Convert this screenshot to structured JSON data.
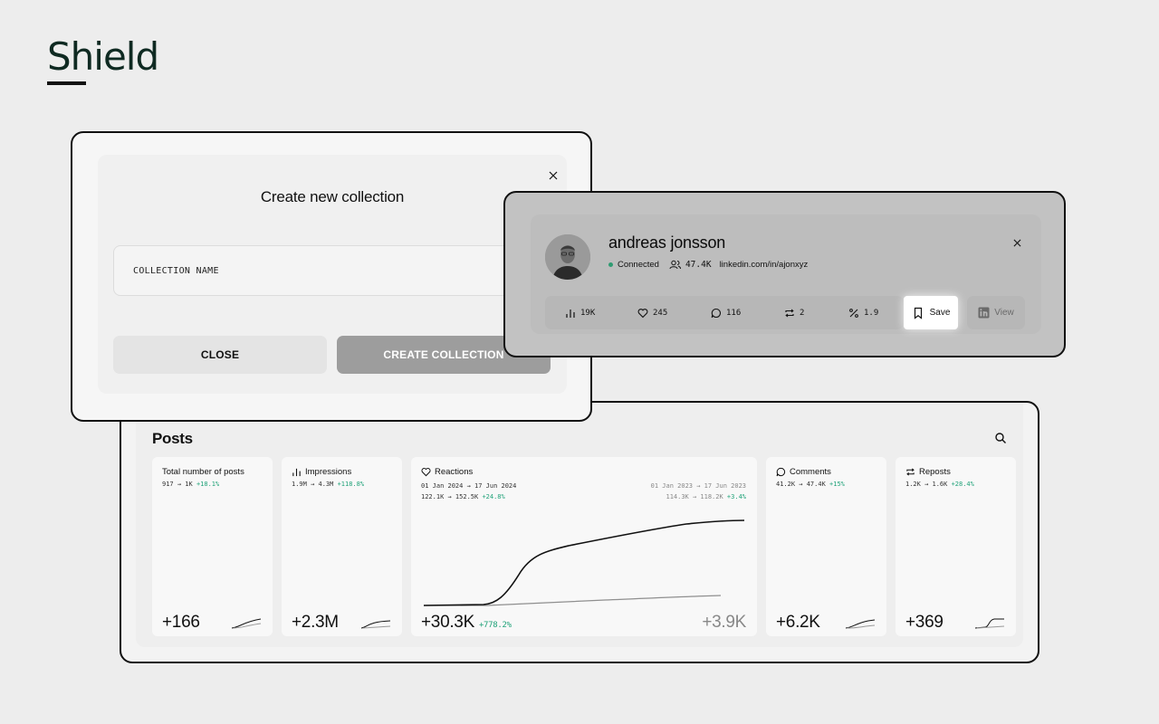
{
  "brand": {
    "name": "Shield"
  },
  "collection_modal": {
    "title": "Create new collection",
    "input_placeholder": "COLLECTION NAME",
    "close_label": "CLOSE",
    "create_label": "CREATE COLLECTION"
  },
  "profile": {
    "name": "andreas jonsson",
    "status": "Connected",
    "followers": "47.4K",
    "url": "linkedin.com/in/ajonxyz",
    "metrics": [
      {
        "icon": "bar-chart-icon",
        "value": "19K"
      },
      {
        "icon": "heart-icon",
        "value": "245"
      },
      {
        "icon": "comment-icon",
        "value": "116"
      },
      {
        "icon": "repost-icon",
        "value": "2"
      },
      {
        "icon": "percent-icon",
        "value": "1.9"
      }
    ],
    "save_label": "Save",
    "view_label": "View"
  },
  "posts": {
    "title": "Posts",
    "cards": {
      "total": {
        "label": "Total number of posts",
        "range": "917 → 1K",
        "change": "+18.1%",
        "value": "+166"
      },
      "impressions": {
        "label": "Impressions",
        "range": "1.9M → 4.3M",
        "change": "+118.8%",
        "value": "+2.3M"
      },
      "reactions": {
        "label": "Reactions",
        "period_current": "01 Jan 2024 → 17 Jun 2024",
        "range_current": "122.1K → 152.5K",
        "change_current": "+24.8%",
        "period_previous": "01 Jan 2023 → 17 Jun 2023",
        "range_previous": "114.3K → 118.2K",
        "change_previous": "+3.4%",
        "value": "+30.3K",
        "value_change": "+778.2%",
        "value_previous": "+3.9K"
      },
      "comments": {
        "label": "Comments",
        "range": "41.2K → 47.4K",
        "change": "+15%",
        "value": "+6.2K"
      },
      "reposts": {
        "label": "Reposts",
        "range": "1.2K → 1.6K",
        "change": "+28.4%",
        "value": "+369"
      }
    }
  },
  "colors": {
    "positive": "#22a37a",
    "connected": "#2f9b72",
    "primary_disabled": "#9d9d9d"
  }
}
